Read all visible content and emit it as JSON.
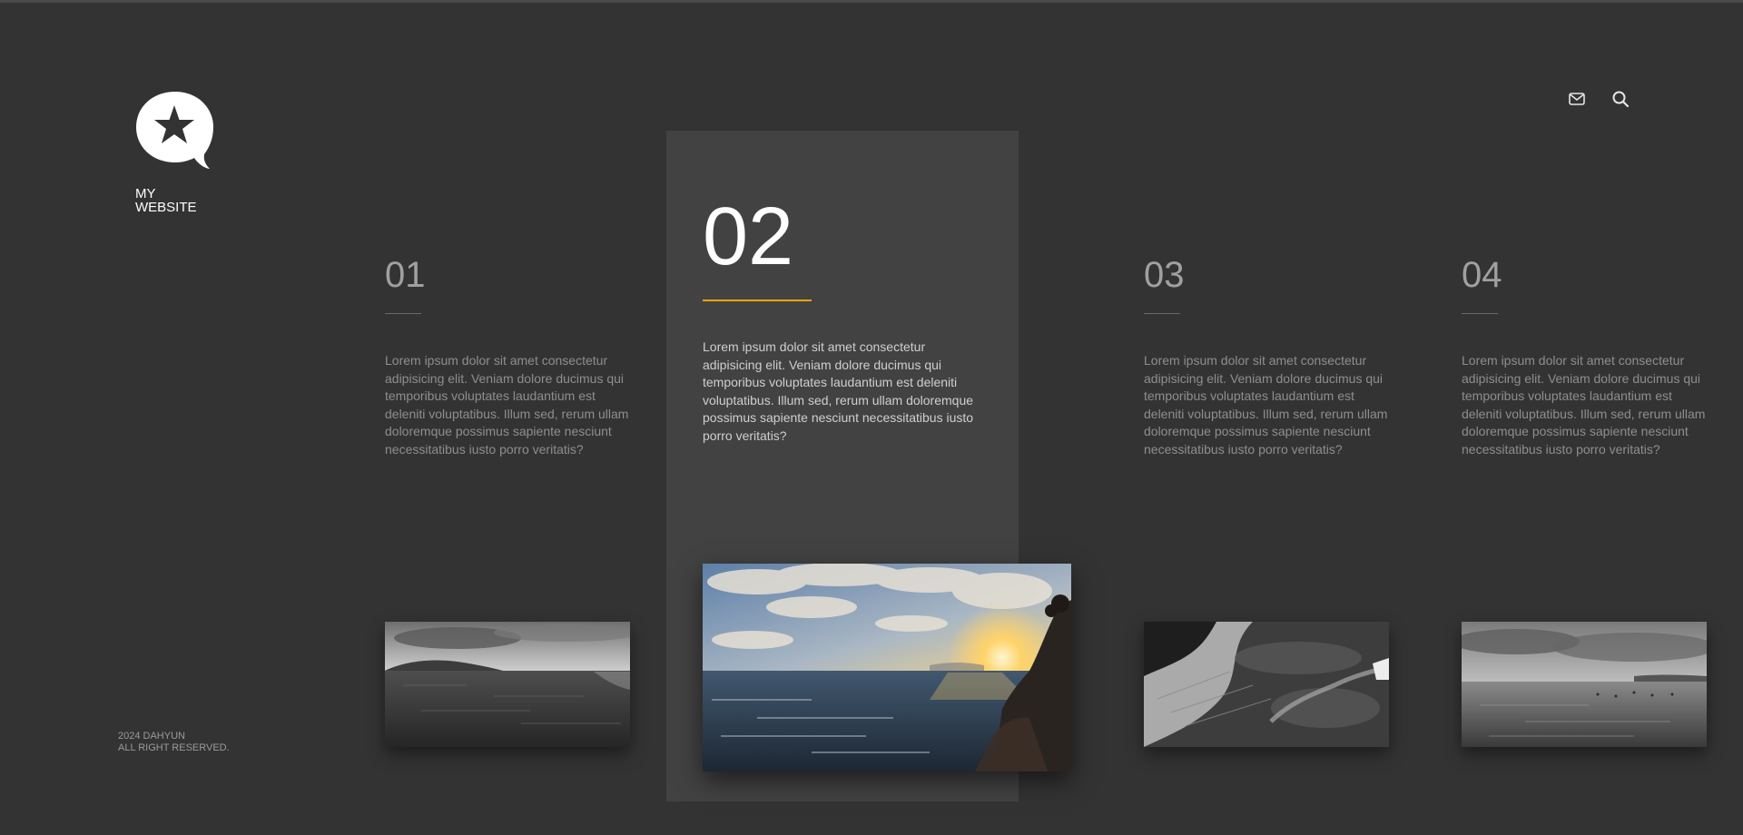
{
  "site": {
    "name_line1": "MY",
    "name_line2": "WEBSITE",
    "footer_line1": "2024 DAHYUN",
    "footer_line2": "ALL RIGHT RESERVED."
  },
  "header": {
    "icons": [
      "mail-icon",
      "search-icon"
    ]
  },
  "cards": [
    {
      "number": "01",
      "text": "Lorem ipsum dolor sit amet consectetur adipisicing elit. Veniam dolore ducimus qui temporibus voluptates laudantium est deleniti voluptatibus. Illum sed, rerum ullam doloremque possimus sapiente nesciunt necessitatibus iusto porro veritatis?",
      "active": false,
      "image": "grayscale-sea-mountain"
    },
    {
      "number": "02",
      "text": "Lorem ipsum dolor sit amet consectetur adipisicing elit. Veniam dolore ducimus qui temporibus voluptates laudantium est deleniti voluptatibus. Illum sed, rerum ullam doloremque possimus sapiente nesciunt necessitatibus iusto porro veritatis?",
      "active": true,
      "image": "sunset-sea-cliff"
    },
    {
      "number": "03",
      "text": "Lorem ipsum dolor sit amet consectetur adipisicing elit. Veniam dolore ducimus qui temporibus voluptates laudantium est deleniti voluptatibus. Illum sed, rerum ullam doloremque possimus sapiente nesciunt necessitatibus iusto porro veritatis?",
      "active": false,
      "image": "grayscale-aerial-waves"
    },
    {
      "number": "04",
      "text": "Lorem ipsum dolor sit amet consectetur adipisicing elit. Veniam dolore ducimus qui temporibus voluptates laudantium est deleniti voluptatibus. Illum sed, rerum ullam doloremque possimus sapiente nesciunt necessitatibus iusto porro veritatis?",
      "active": false,
      "image": "grayscale-sea-horizon"
    }
  ],
  "colors": {
    "background": "#333333",
    "active_panel": "#424242",
    "accent": "#f0a500"
  }
}
